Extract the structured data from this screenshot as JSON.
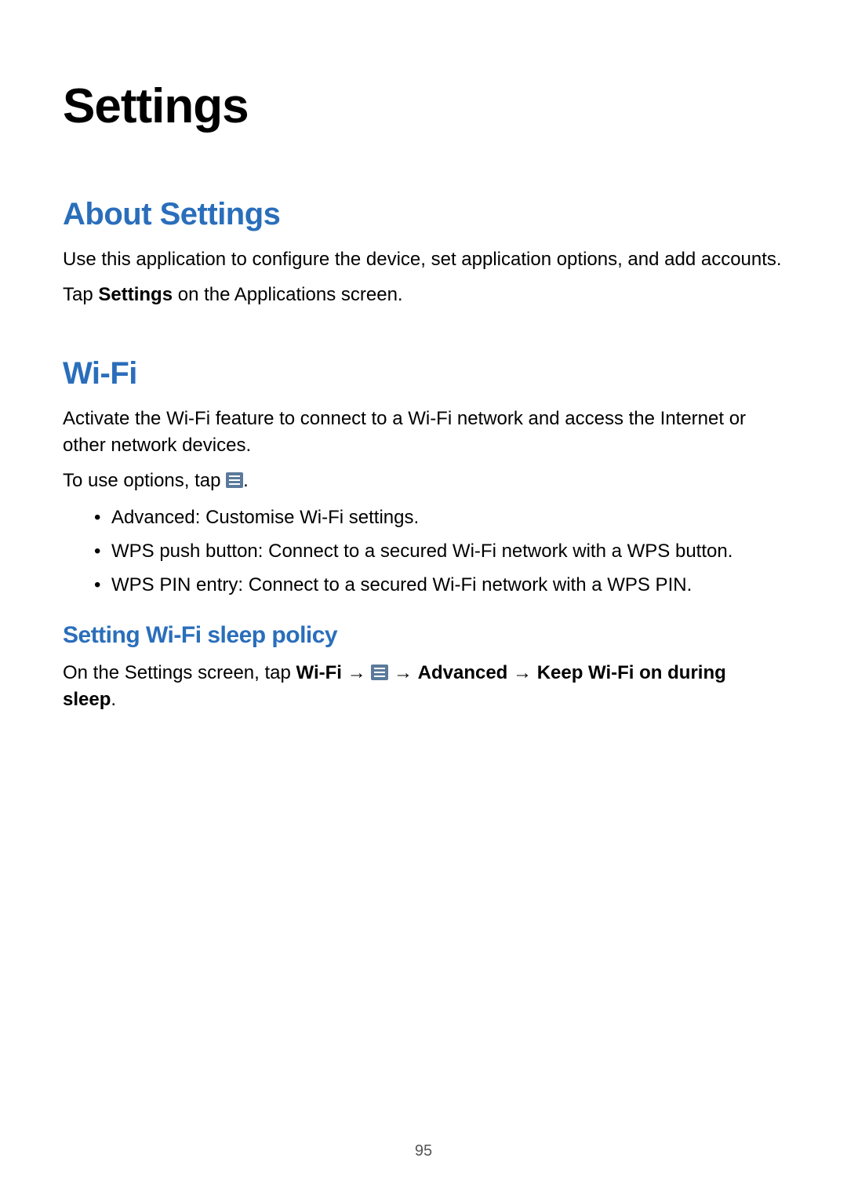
{
  "page": {
    "title": "Settings",
    "number": "95"
  },
  "about": {
    "heading": "About Settings",
    "p1": "Use this application to configure the device, set application options, and add accounts.",
    "p2_pre": "Tap ",
    "p2_bold": "Settings",
    "p2_post": " on the Applications screen."
  },
  "wifi": {
    "heading": "Wi-Fi",
    "p1": "Activate the Wi-Fi feature to connect to a Wi-Fi network and access the Internet or other network devices.",
    "p2_pre": "To use options, tap ",
    "p2_post": ".",
    "options": [
      {
        "bold": "Advanced",
        "rest": ": Customise Wi-Fi settings."
      },
      {
        "bold": "WPS push button",
        "rest": ": Connect to a secured Wi-Fi network with a WPS button."
      },
      {
        "bold": "WPS PIN entry",
        "rest": ": Connect to a secured Wi-Fi network with a WPS PIN."
      }
    ],
    "sleep": {
      "heading": "Setting Wi-Fi sleep policy",
      "pre": "On the Settings screen, tap ",
      "wifi_bold": "Wi-Fi",
      "arrow": " → ",
      "advanced_bold": "Advanced",
      "keep_bold": "Keep Wi-Fi on during sleep",
      "period": "."
    }
  }
}
